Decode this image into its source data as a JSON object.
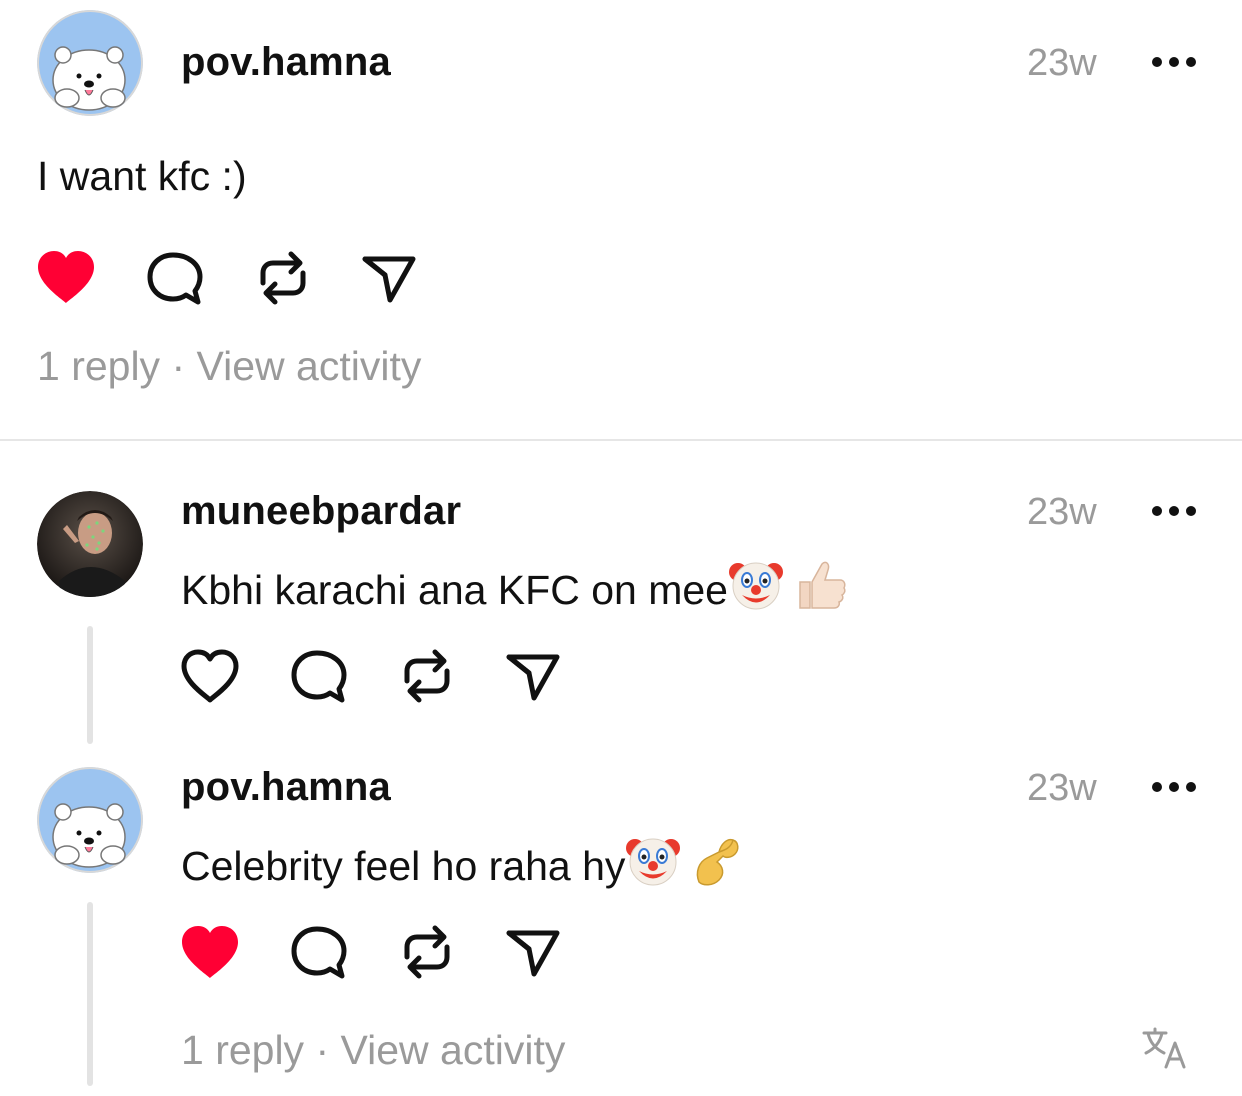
{
  "post": {
    "username": "pov.hamna",
    "time": "23w",
    "text": "I want kfc :)",
    "liked": true,
    "replies": "1 reply",
    "separator": "·",
    "view_activity": "View activity"
  },
  "replies": [
    {
      "username": "muneebpardar",
      "time": "23w",
      "text": "Kbhi karachi ana KFC on mee",
      "emojis": [
        "clown-face-emoji",
        "thumbs-up-emoji"
      ],
      "liked": false
    },
    {
      "username": "pov.hamna",
      "time": "23w",
      "text": "Celebrity feel ho raha hy",
      "emojis": [
        "clown-face-emoji",
        "pinching-hand-emoji"
      ],
      "liked": true,
      "replies": "1 reply",
      "separator": "·",
      "view_activity": "View activity"
    }
  ],
  "colors": {
    "like_red": "#ff0034",
    "muted": "#9a9a9a",
    "divider": "#e6e6e6",
    "avatar_blue": "#9cc4f0"
  },
  "icons": [
    "heart-icon",
    "comment-icon",
    "repost-icon",
    "share-icon",
    "more-icon",
    "translate-icon"
  ]
}
